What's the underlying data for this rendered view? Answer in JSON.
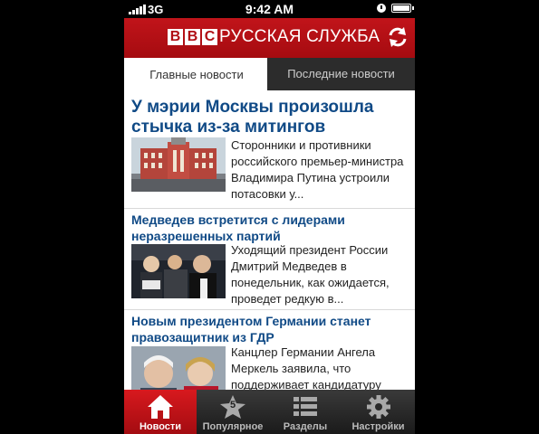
{
  "status_bar": {
    "network": "3G",
    "time": "9:42 AM"
  },
  "header": {
    "logo": "BBC",
    "logo_letters": [
      "B",
      "B",
      "C"
    ],
    "service": "РУССКАЯ СЛУЖБА",
    "refresh_icon": "refresh-icon"
  },
  "tabs": [
    {
      "label": "Главные новости",
      "active": true
    },
    {
      "label": "Последние новости",
      "active": false
    }
  ],
  "stories": [
    {
      "headline": "У мэрии Москвы произошла стычка из-за митингов",
      "summary": "Сторонники и противники российского премьер-министра Владимира Путина устроили потасовки у..."
    },
    {
      "headline": "Медведев встретится с лидерами неразрешенных партий",
      "summary": "Уходящий президент России Дмитрий Медведев в понедельник, как ожидается, проведет редкую в..."
    },
    {
      "headline": "Новым президентом Германии станет правозащитник из ГДР",
      "summary": "Канцлер Германии Ангела Меркель заявила, что поддерживает кандидатуру"
    }
  ],
  "tab_bar": [
    {
      "label": "Новости",
      "icon": "home-icon",
      "active": true
    },
    {
      "label": "Популярное",
      "icon": "star-icon",
      "badge": "5",
      "active": false
    },
    {
      "label": "Разделы",
      "icon": "list-icon",
      "active": false
    },
    {
      "label": "Настройки",
      "icon": "gear-icon",
      "active": false
    }
  ],
  "colors": {
    "brand_red": "#b00f14",
    "headline_blue": "#104a86"
  }
}
